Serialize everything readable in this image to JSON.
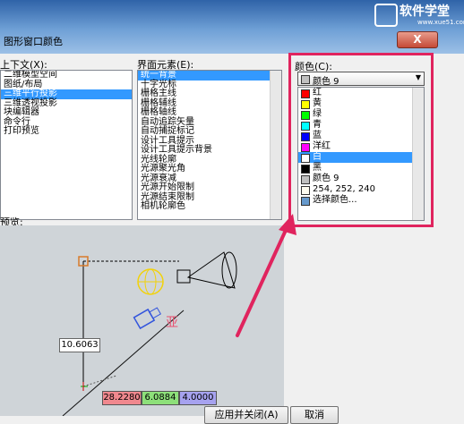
{
  "window": {
    "title": "图形窗口颜色",
    "close_label": "X"
  },
  "logo": {
    "name": "软件学堂",
    "url": "www.xue51.com"
  },
  "context": {
    "label": "上下文(X):",
    "items": [
      "二维模型空间",
      "图纸/布局",
      "三维平行投影",
      "三维透视投影",
      "块编辑器",
      "命令行",
      "打印预览"
    ],
    "selected_index": 2
  },
  "interface": {
    "label": "界面元素(E):",
    "items": [
      "统一背景",
      "十字光标",
      "栅格主线",
      "栅格辅线",
      "栅格轴线",
      "自动追踪矢量",
      "自动捕捉标记",
      "设计工具提示",
      "设计工具提示背景",
      "光线轮廓",
      "光源聚光角",
      "光源衰减",
      "光源开始限制",
      "光源结束限制",
      "相机轮廓色"
    ],
    "selected_index": 0
  },
  "preview": {
    "label": "预览:",
    "coord_value": "10.6063",
    "x_value": "28.2280",
    "y_value": "6.0884",
    "z_value": "4.0000"
  },
  "color": {
    "label": "颜色(C):",
    "selected": {
      "name": "颜色 9",
      "swatch": "#c0c0c0"
    },
    "options": [
      {
        "name": "红",
        "swatch": "#ff0000"
      },
      {
        "name": "黄",
        "swatch": "#ffff00"
      },
      {
        "name": "绿",
        "swatch": "#00ff00"
      },
      {
        "name": "青",
        "swatch": "#00ffff"
      },
      {
        "name": "蓝",
        "swatch": "#0000ff"
      },
      {
        "name": "洋红",
        "swatch": "#ff00ff"
      },
      {
        "name": "白",
        "swatch": "#ffffff"
      },
      {
        "name": "黑",
        "swatch": "#000000"
      },
      {
        "name": "颜色 9",
        "swatch": "#c0c0c0"
      },
      {
        "name": "254, 252, 240",
        "swatch": "#fefcf0"
      },
      {
        "name": "选择颜色...",
        "swatch": "#6699cc"
      }
    ],
    "selected_index": 6,
    "highlight_color": "#e0245e"
  },
  "buttons": {
    "apply_close": "应用并关闭(A)",
    "cancel": "取消"
  }
}
